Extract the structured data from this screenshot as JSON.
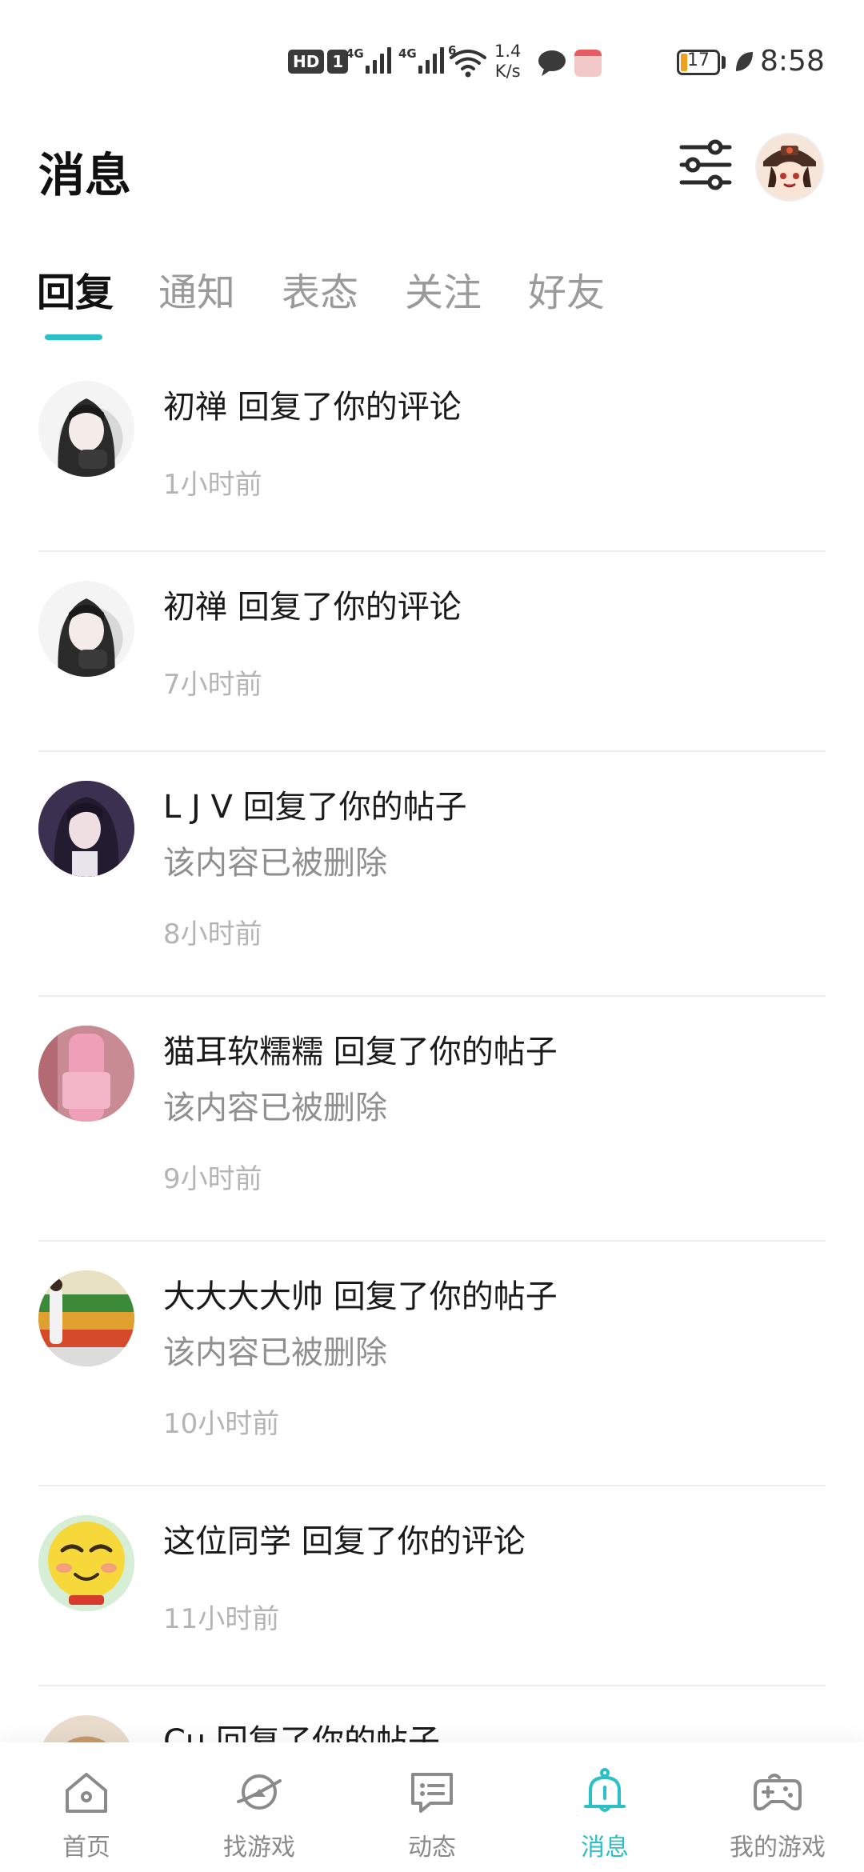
{
  "status_bar": {
    "hd_label": "HD",
    "sim_label": "1",
    "network_1": "4G",
    "network_2": "4G",
    "wifi_label": "6",
    "speed_value": "1.4",
    "speed_unit": "K/s",
    "battery": "17",
    "time": "8:58"
  },
  "header": {
    "title": "消息",
    "filter_icon": "sliders-icon",
    "avatar": "user-avatar"
  },
  "tabs": [
    {
      "label": "回复",
      "active": true
    },
    {
      "label": "通知",
      "active": false
    },
    {
      "label": "表态",
      "active": false
    },
    {
      "label": "关注",
      "active": false
    },
    {
      "label": "好友",
      "active": false
    }
  ],
  "messages": [
    {
      "title": "初禅 回复了你的评论",
      "snippet": "",
      "time": "1小时前"
    },
    {
      "title": "初禅 回复了你的评论",
      "snippet": "",
      "time": "7小时前"
    },
    {
      "title": "L J V 回复了你的帖子",
      "snippet": "该内容已被删除",
      "time": "8小时前"
    },
    {
      "title": "猫耳软糯糯 回复了你的帖子",
      "snippet": "该内容已被删除",
      "time": "9小时前"
    },
    {
      "title": "大大大大帅 回复了你的帖子",
      "snippet": "该内容已被删除",
      "time": "10小时前"
    },
    {
      "title": "这位同学 回复了你的评论",
      "snippet": "",
      "time": "11小时前"
    },
    {
      "title": "Cu 回复了你的帖子",
      "snippet": "",
      "time": ""
    }
  ],
  "bottom_nav": [
    {
      "label": "首页",
      "icon": "home-icon",
      "active": false
    },
    {
      "label": "找游戏",
      "icon": "planet-icon",
      "active": false
    },
    {
      "label": "动态",
      "icon": "message-square-icon",
      "active": false
    },
    {
      "label": "消息",
      "icon": "bell-icon",
      "active": true
    },
    {
      "label": "我的游戏",
      "icon": "gamepad-icon",
      "active": false
    }
  ],
  "colors": {
    "accent": "#2bbfc7",
    "text_primary": "#1a1a1a",
    "text_secondary": "#8f8f8f",
    "text_muted": "#b4b4b4"
  }
}
